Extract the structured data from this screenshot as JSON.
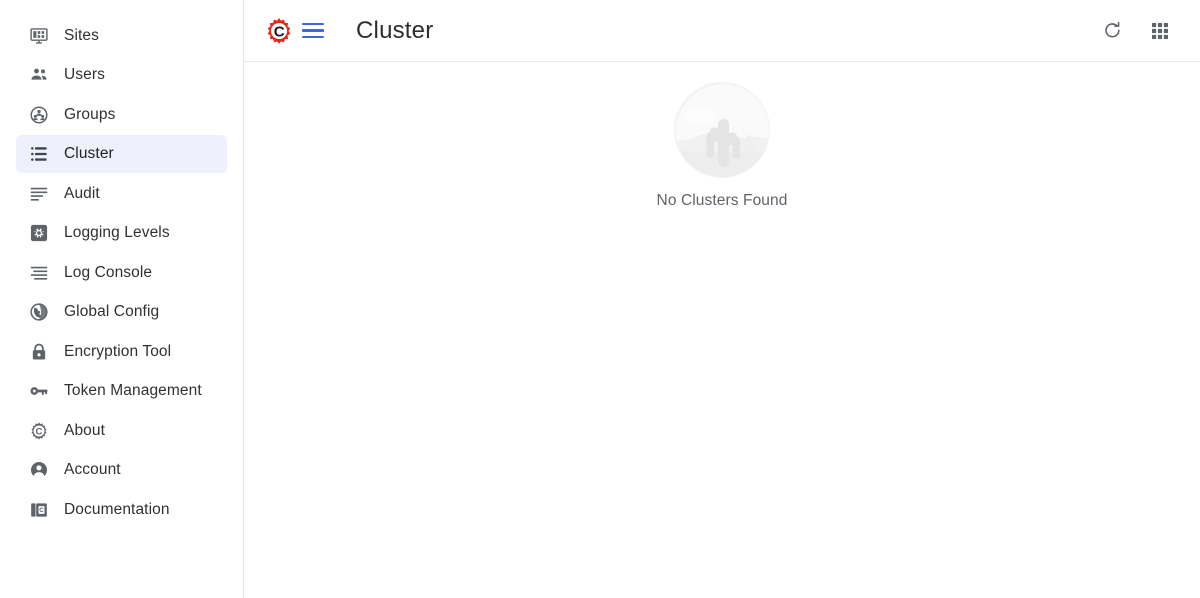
{
  "app": {
    "accent_blue": "#3b68dd",
    "logo_red": "#e8261c",
    "active_item_bg": "#eef1fb",
    "text_color": "#2f3133",
    "muted_text_color": "#5f6368"
  },
  "sidebar": {
    "items": [
      {
        "label": "Sites",
        "icon": "dashboard-monitor-icon",
        "active": false
      },
      {
        "label": "Users",
        "icon": "users-icon",
        "active": false
      },
      {
        "label": "Groups",
        "icon": "groups-circle-icon",
        "active": false
      },
      {
        "label": "Cluster",
        "icon": "cluster-list-icon",
        "active": true
      },
      {
        "label": "Audit",
        "icon": "audit-lines-icon",
        "active": false
      },
      {
        "label": "Logging Levels",
        "icon": "gear-square-icon",
        "active": false
      },
      {
        "label": "Log Console",
        "icon": "log-console-icon",
        "active": false
      },
      {
        "label": "Global Config",
        "icon": "globe-icon",
        "active": false
      },
      {
        "label": "Encryption Tool",
        "icon": "lock-icon",
        "active": false
      },
      {
        "label": "Token Management",
        "icon": "key-icon",
        "active": false
      },
      {
        "label": "About",
        "icon": "gear-c-icon",
        "active": false
      },
      {
        "label": "Account",
        "icon": "account-circle-icon",
        "active": false
      },
      {
        "label": "Documentation",
        "icon": "book-icon",
        "active": false
      }
    ]
  },
  "topbar": {
    "logo_icon": "gear-c-logo-icon",
    "menu_icon": "hamburger-menu-icon",
    "title": "Cluster",
    "refresh_icon": "refresh-icon",
    "apps_grid_icon": "apps-grid-icon"
  },
  "main": {
    "empty_state": {
      "illustration_icon": "desert-cactus-empty-icon",
      "message": "No Clusters Found"
    }
  }
}
